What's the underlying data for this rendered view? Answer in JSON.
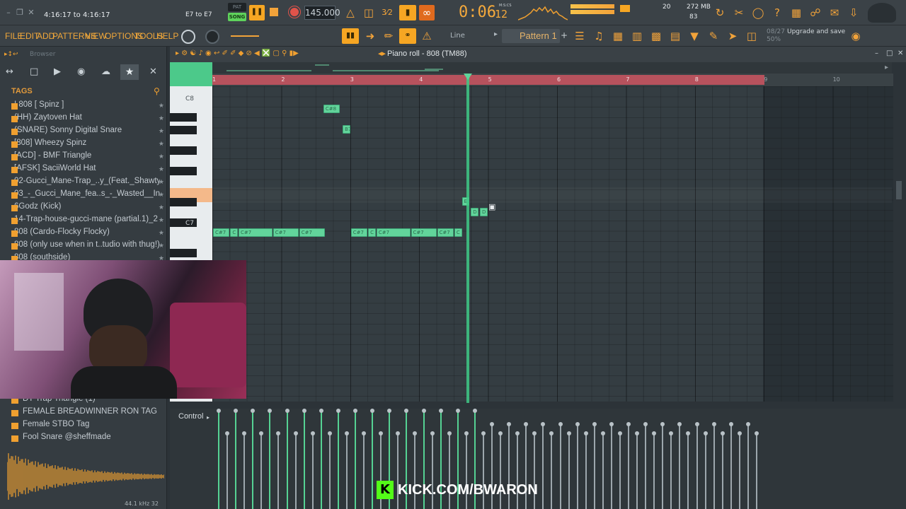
{
  "transport": {
    "hint_text": "4:16:17 to 4:16:17",
    "range_text": "E7 to E7",
    "pat_label": "PAT",
    "song_label": "SONG",
    "tempo": "145.000",
    "time_main": "0:06",
    "time_sub": "12",
    "time_unit": "M:S:CS",
    "cpu": "20",
    "memory": "272 MB",
    "polyphony": "83"
  },
  "menu": {
    "items": [
      "FILE",
      "EDIT",
      "ADD",
      "PATTERNS",
      "VIEW",
      "OPTIONS",
      "TOOLS",
      "HELP"
    ],
    "snap_label": "Line",
    "pattern_label": "Pattern 1",
    "news_counter": "08/27",
    "news_text": "Upgrade and save",
    "news_sub": "50%"
  },
  "browser": {
    "title": "Browser",
    "section": "TAGS",
    "items": [
      "! 808 [ Spinz ]",
      "(HH) Zaytoven Hat",
      "(SNARE) Sonny Digital Snare",
      "[808] Wheezy Spinz",
      "[ACD] - BMF Triangle",
      "[AFSK] SaciiWorld Hat",
      "02-Gucci_Mane-Trap_..y_(Feat._Shawty_Lo)",
      "03_-_Gucci_Mane_fea..s_-_Wasted__Instr_1",
      "6Godz (Kick)",
      "14-Trap-house-gucci-mane (partial.1)_2",
      "808 (Cardo-Flocky Flocky)",
      "808 (only use when in t..tudio with thug!) (3)",
      "808 (southside)"
    ],
    "lower_items": [
      "DT Trap Triangle (1)",
      "FEMALE BREADWINNER RON TAG",
      "Female STBO Tag",
      "Fool Snare @sheffmade"
    ],
    "sample_info": "44.1 kHz 32"
  },
  "pianoroll": {
    "title": "Piano roll - 808 (TM88)",
    "bars": [
      "1",
      "2",
      "3",
      "4",
      "5",
      "6",
      "7",
      "8",
      "9",
      "10"
    ],
    "key_labels": [
      "C8",
      "C7"
    ],
    "control_label": "Control",
    "notes": [
      {
        "label": "C#8",
        "bar": 2.6,
        "len": 0.25,
        "row": 1
      },
      {
        "label": "B7",
        "bar": 2.88,
        "len": 0.12,
        "row": 3
      },
      {
        "label": "E7",
        "bar": 4.61,
        "len": 0.12,
        "row": 10
      },
      {
        "label": "D",
        "bar": 4.74,
        "len": 0.12,
        "row": 11
      },
      {
        "label": "D",
        "bar": 4.87,
        "len": 0.12,
        "row": 11
      },
      {
        "label": "C#7",
        "bar": 1.0,
        "len": 0.25,
        "row": 13
      },
      {
        "label": "C",
        "bar": 1.25,
        "len": 0.12,
        "row": 13
      },
      {
        "label": "C#7",
        "bar": 1.37,
        "len": 0.5,
        "row": 13
      },
      {
        "label": "C#7",
        "bar": 1.87,
        "len": 0.38,
        "row": 13
      },
      {
        "label": "C#7",
        "bar": 2.25,
        "len": 0.38,
        "row": 13
      },
      {
        "label": "C#7",
        "bar": 3.0,
        "len": 0.25,
        "row": 13
      },
      {
        "label": "C",
        "bar": 3.25,
        "len": 0.12,
        "row": 13
      },
      {
        "label": "C#7",
        "bar": 3.37,
        "len": 0.5,
        "row": 13
      },
      {
        "label": "C#7",
        "bar": 3.87,
        "len": 0.38,
        "row": 13
      },
      {
        "label": "C#7",
        "bar": 4.25,
        "len": 0.25,
        "row": 13
      },
      {
        "label": "C",
        "bar": 4.5,
        "len": 0.12,
        "row": 13
      }
    ],
    "playhead_bar": 4.7
  },
  "overlay": {
    "kick_text": "KICK.COM/BWARON"
  },
  "colors": {
    "accent_orange": "#f6a623",
    "note_green": "#62d49b",
    "loop_red": "#b7525d"
  }
}
